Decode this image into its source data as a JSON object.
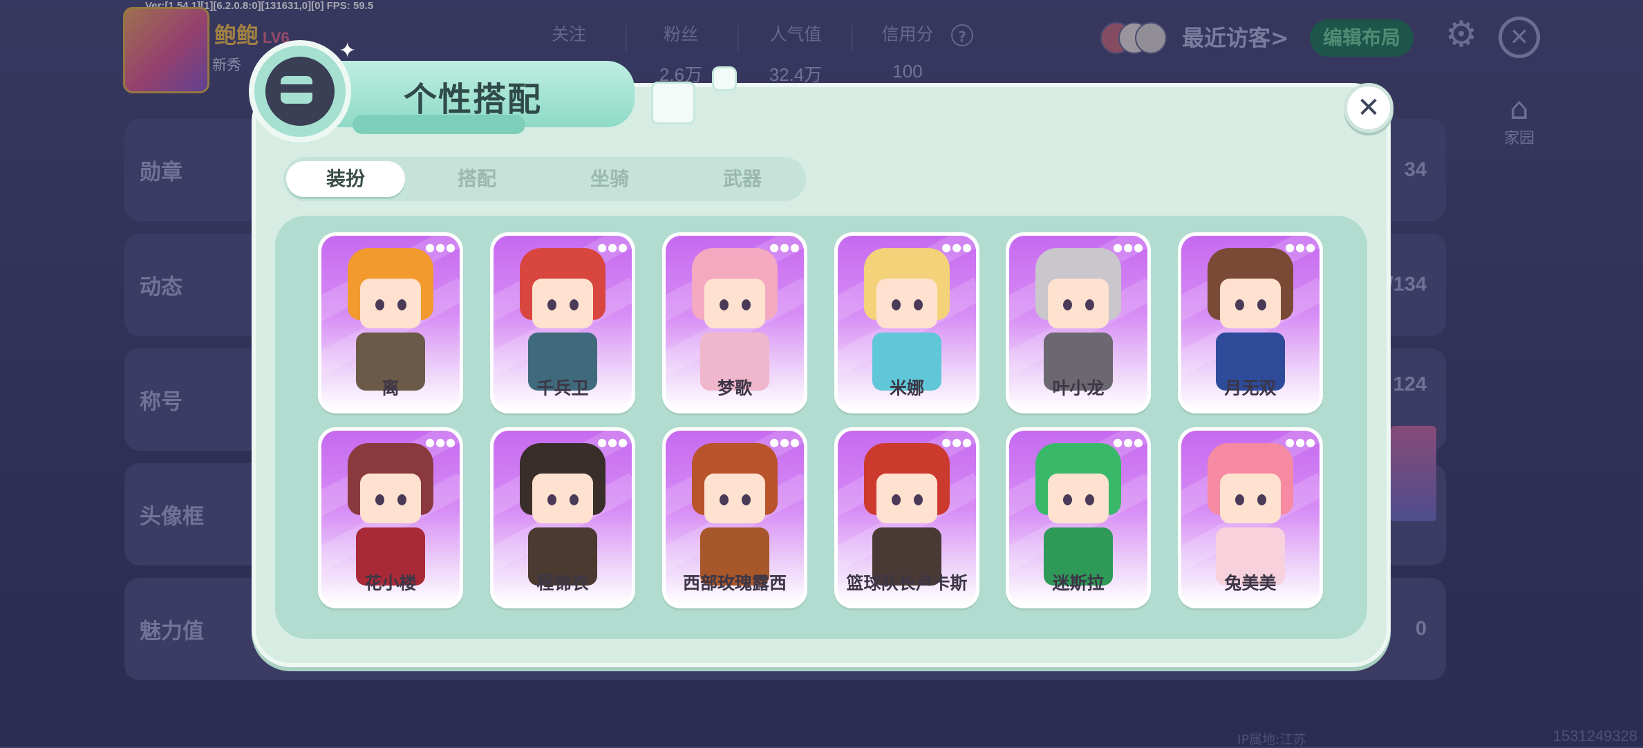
{
  "debug": "Ver:[1.54.1][1][6.2.0.8:0][131631,0][0] FPS: 59.5",
  "profile": {
    "nickname": "鲍鲍",
    "level": "LV6",
    "newbie_label": "新秀"
  },
  "stats": [
    {
      "label": "关注",
      "value": ""
    },
    {
      "label": "粉丝",
      "value": "2.6万"
    },
    {
      "label": "人气值",
      "value": "32.4万"
    },
    {
      "label": "信用分",
      "value": "100"
    }
  ],
  "header": {
    "help_icon": "?",
    "visitors_label": "最近访客>",
    "edit_layout_label": "编辑布局",
    "settings_icon": "⚙",
    "close_icon": "✕",
    "home_icon": "⌂",
    "home_label": "家园"
  },
  "rows": [
    {
      "label": "勋章",
      "value": "34"
    },
    {
      "label": "动态",
      "value": "/134"
    },
    {
      "label": "称号",
      "value": "124"
    },
    {
      "label": "头像框",
      "value": ""
    },
    {
      "label": "魅力值",
      "value": "0"
    }
  ],
  "footer": {
    "ip_label": "IP属地:江苏",
    "uid": "1531249328"
  },
  "modal": {
    "title": "个性搭配",
    "close_icon": "✕",
    "sparkle_icon": "✦",
    "tabs": [
      {
        "label": "装扮",
        "active": true
      },
      {
        "label": "搭配",
        "active": false
      },
      {
        "label": "坐骑",
        "active": false
      },
      {
        "label": "武器",
        "active": false
      }
    ],
    "more_icon": "●●●",
    "characters": [
      {
        "name": "离",
        "hair": "#f29a2e",
        "body": "#6b5a48"
      },
      {
        "name": "千兵卫",
        "hair": "#d9463f",
        "body": "#3f6a7c"
      },
      {
        "name": "梦歌",
        "hair": "#f4a9c0",
        "body": "#f0b6cb"
      },
      {
        "name": "米娜",
        "hair": "#f4d27a",
        "body": "#5fc7d8"
      },
      {
        "name": "叶小龙",
        "hair": "#c9c6cc",
        "body": "#6c6870"
      },
      {
        "name": "月无双",
        "hair": "#7a4a36",
        "body": "#2e4b9a"
      },
      {
        "name": "花小楼",
        "hair": "#8a3a3e",
        "body": "#a82a36"
      },
      {
        "name": "程锦衣",
        "hair": "#3a2e2a",
        "body": "#4a3a30"
      },
      {
        "name": "西部玫瑰露西",
        "hair": "#b8532c",
        "body": "#a8572a"
      },
      {
        "name": "篮球队长卢卡斯",
        "hair": "#cc3a2e",
        "body": "#4a3a36"
      },
      {
        "name": "迷斯拉",
        "hair": "#3ab86a",
        "body": "#2f9a58"
      },
      {
        "name": "兔美美",
        "hair": "#f58aa2",
        "body": "#f7d2dd"
      }
    ]
  },
  "colors": {
    "accent_green": "#1f7a56",
    "modal_bg": "#d7ede4",
    "card_purple": "#c66af0"
  }
}
